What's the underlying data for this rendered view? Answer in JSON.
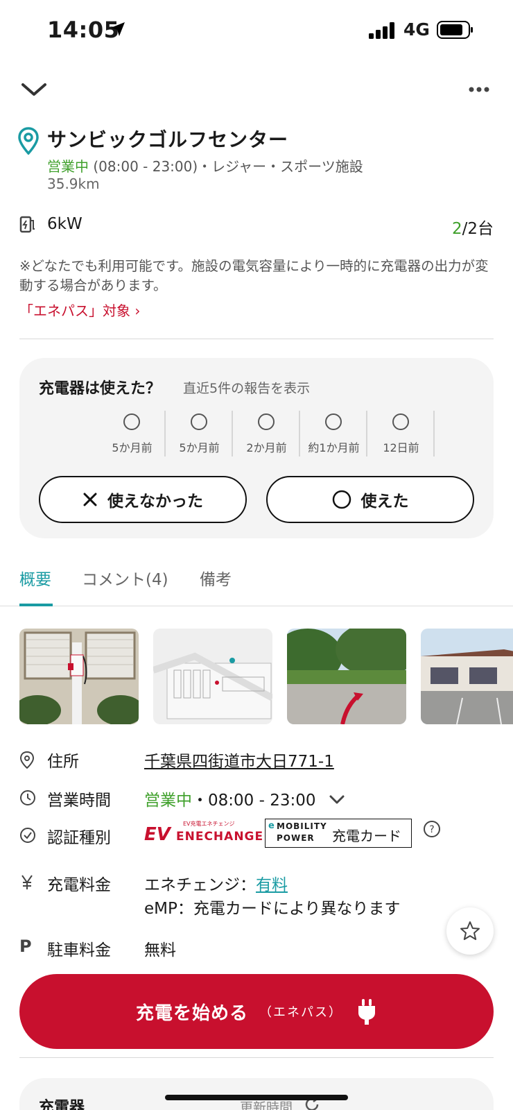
{
  "status_bar": {
    "time": "14:05",
    "network": "4G"
  },
  "place": {
    "name": "サンビックゴルフセンター",
    "status": "営業中",
    "hours_category": " (08:00 - 23:00)・レジャー・スポーツ施設",
    "distance": "35.9km"
  },
  "charger": {
    "power": "6kW",
    "available": "2",
    "total": "/2台"
  },
  "note": "※どなたでも利用可能です。施設の電気容量により一時的に充電器の出力が変動する場合があります。",
  "enepass_link": "「エネパス」対象 ›",
  "report": {
    "title": "充電器は使えた？",
    "subtitle": "直近5件の報告を表示",
    "items": [
      {
        "date": "5か月前"
      },
      {
        "date": "5か月前"
      },
      {
        "date": "2か月前"
      },
      {
        "date": "約1か月前"
      },
      {
        "date": "12日前"
      }
    ],
    "btn_no": "使えなかった",
    "btn_yes": "使えた"
  },
  "tabs": [
    {
      "label": "概要",
      "active": true
    },
    {
      "label": "コメント(4)",
      "active": false
    },
    {
      "label": "備考",
      "active": false
    }
  ],
  "info": {
    "address_label": "住所",
    "address": "千葉県四街道市大日771-1",
    "hours_label": "営業時間",
    "hours_status": "営業中",
    "hours": "・08:00 - 23:00",
    "auth_label": "認証種別",
    "auth_brand1_small": "EV充電エネチェンジ",
    "auth_brand1": "ENECHANGE",
    "auth_brand2_top": "MOBILITY",
    "auth_brand2_bottom": "POWER",
    "auth_card": "充電カード",
    "fee_label": "充電料金",
    "fee_line1_prefix": "エネチェンジ：",
    "fee_line1_link": "有料",
    "fee_line2": "eMP：充電カードにより異なります",
    "parking_label": "駐車料金",
    "parking": "無料"
  },
  "cta": {
    "main": "充電を始める",
    "sub": "（エネパス）"
  },
  "charger_section": {
    "title": "充電器",
    "updated": "更新時間"
  },
  "colors": {
    "accent_red": "#c8102e",
    "teal": "#1a9ba3",
    "green": "#3fa02b"
  }
}
